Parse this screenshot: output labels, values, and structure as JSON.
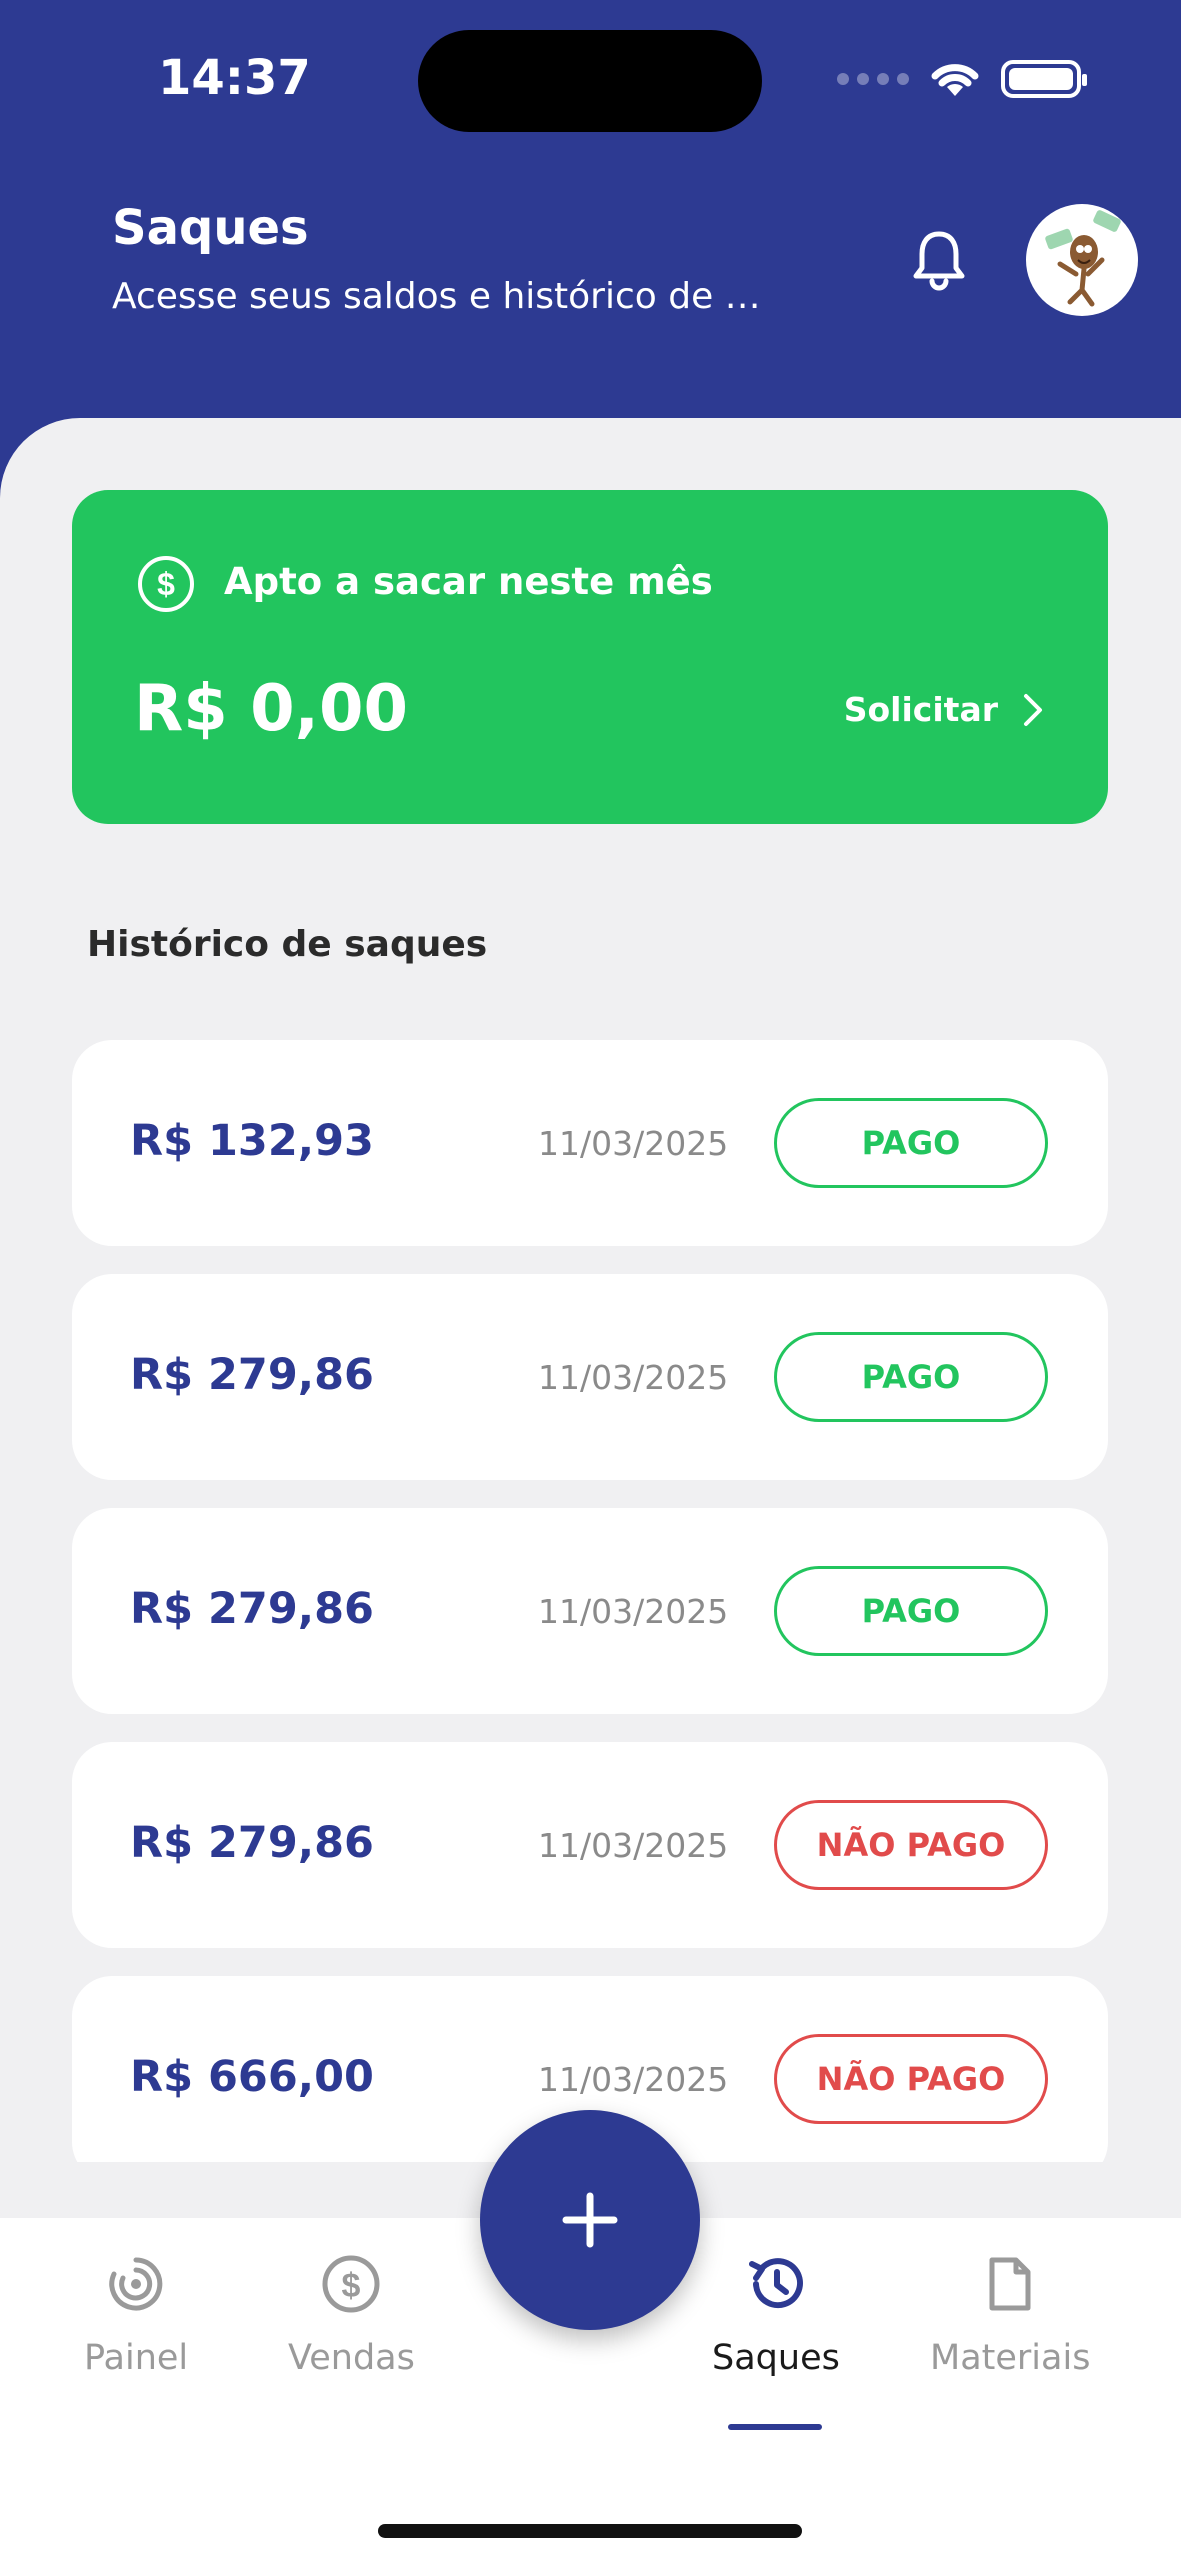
{
  "status_bar": {
    "time": "14:37"
  },
  "header": {
    "title": "Saques",
    "subtitle": "Acesse seus saldos e histórico de s..."
  },
  "balance_card": {
    "label": "Apto a sacar neste mês",
    "value": "R$ 0,00",
    "request_label": "Solicitar"
  },
  "history": {
    "title": "Histórico de saques",
    "rows": [
      {
        "amount": "R$ 132,93",
        "date": "11/03/2025",
        "status": "PAGO"
      },
      {
        "amount": "R$ 279,86",
        "date": "11/03/2025",
        "status": "PAGO"
      },
      {
        "amount": "R$ 279,86",
        "date": "11/03/2025",
        "status": "PAGO"
      },
      {
        "amount": "R$ 279,86",
        "date": "11/03/2025",
        "status": "NÃO PAGO"
      },
      {
        "amount": "R$ 666,00",
        "date": "11/03/2025",
        "status": "NÃO PAGO"
      }
    ]
  },
  "tabbar": {
    "items": [
      {
        "label": "Painel",
        "icon": "dashboard-icon",
        "active": false
      },
      {
        "label": "Vendas",
        "icon": "dollar-icon",
        "active": false
      },
      {
        "label": "Saques",
        "icon": "history-icon",
        "active": true
      },
      {
        "label": "Materiais",
        "icon": "document-icon",
        "active": false
      }
    ]
  },
  "colors": {
    "primary": "#2d3a92",
    "success": "#22c55e",
    "danger": "#e14b4b",
    "background": "#f0f0f2"
  }
}
